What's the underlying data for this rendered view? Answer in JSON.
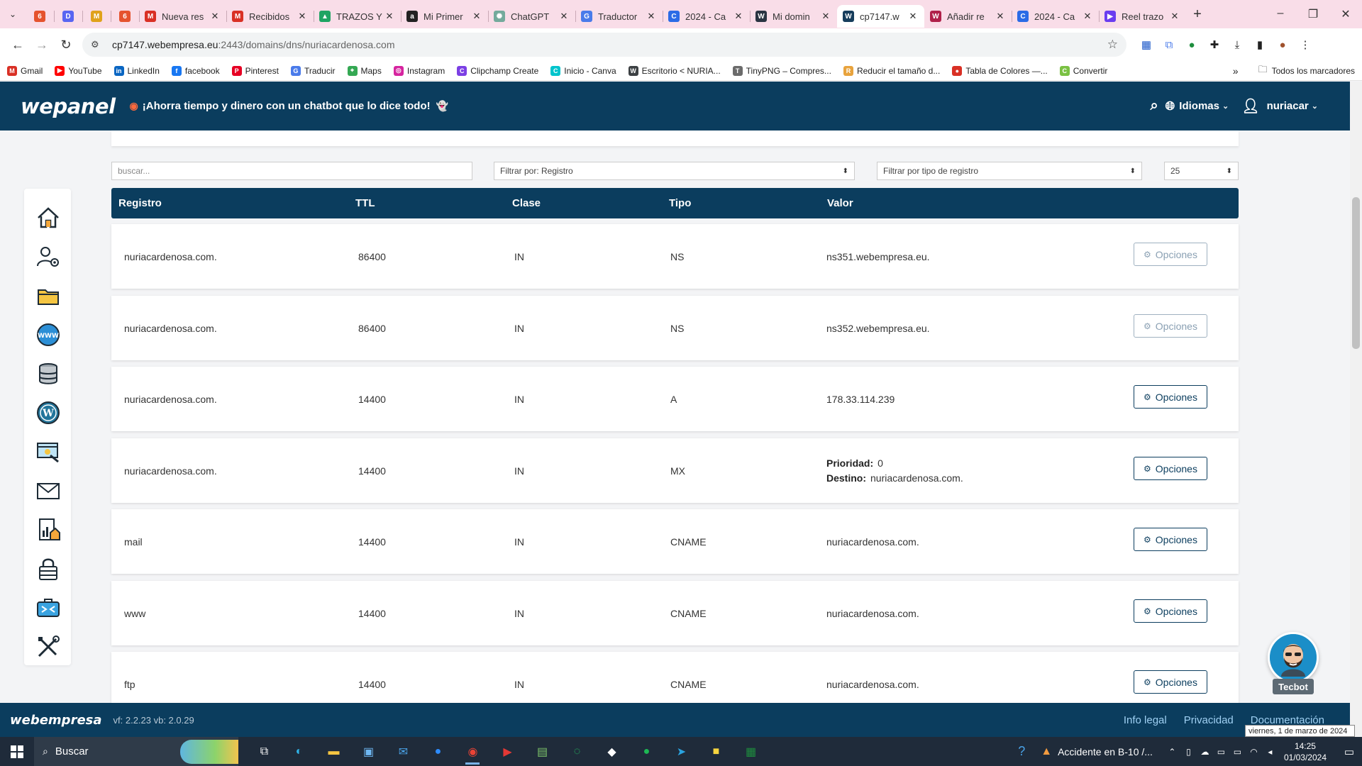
{
  "browser": {
    "tabs": [
      {
        "title": "",
        "color": "#e5532e",
        "glyph": "6",
        "small": true
      },
      {
        "title": "",
        "color": "#5865f2",
        "glyph": "D",
        "small": true
      },
      {
        "title": "",
        "color": "#e0a21b",
        "glyph": "M",
        "small": true
      },
      {
        "title": "",
        "color": "#e5532e",
        "glyph": "6",
        "small": true
      },
      {
        "title": "Nueva res",
        "color": "#d93025",
        "glyph": "M"
      },
      {
        "title": "Recibidos",
        "color": "#d93025",
        "glyph": "M"
      },
      {
        "title": "TRAZOS Y",
        "color": "#1fa463",
        "glyph": "▲"
      },
      {
        "title": "Mi Primer",
        "color": "#222222",
        "glyph": "a"
      },
      {
        "title": "ChatGPT",
        "color": "#74aa9c",
        "glyph": "✺"
      },
      {
        "title": "Traductor",
        "color": "#4a7bea",
        "glyph": "G"
      },
      {
        "title": "2024 - Ca",
        "color": "#2b6be6",
        "glyph": "C"
      },
      {
        "title": "Mi domin",
        "color": "#2a3442",
        "glyph": "W"
      },
      {
        "title": "cp7147.w",
        "color": "#173d5c",
        "glyph": "W",
        "active": true
      },
      {
        "title": "Añadir re",
        "color": "#b0204a",
        "glyph": "W"
      },
      {
        "title": "2024 - Ca",
        "color": "#2b6be6",
        "glyph": "C"
      },
      {
        "title": "Reel trazo",
        "color": "#6a3cf0",
        "glyph": "▶"
      }
    ],
    "url_host": "cp7147.webempresa.eu",
    "url_path": ":2443/domains/dns/nuriacardenosa.com",
    "bookmarks": [
      {
        "label": "Gmail",
        "color": "#d93025",
        "glyph": "M"
      },
      {
        "label": "YouTube",
        "color": "#ff0000",
        "glyph": "▶"
      },
      {
        "label": "LinkedIn",
        "color": "#0a66c2",
        "glyph": "in"
      },
      {
        "label": "facebook",
        "color": "#1877f2",
        "glyph": "f"
      },
      {
        "label": "Pinterest",
        "color": "#e60023",
        "glyph": "P"
      },
      {
        "label": "Traducir",
        "color": "#4a7bea",
        "glyph": "G"
      },
      {
        "label": "Maps",
        "color": "#34a853",
        "glyph": "⌖"
      },
      {
        "label": "Instagram",
        "color": "#d6249f",
        "glyph": "◎"
      },
      {
        "label": "Clipchamp Create",
        "color": "#7b3fe4",
        "glyph": "C"
      },
      {
        "label": "Inicio - Canva",
        "color": "#00c4cc",
        "glyph": "C"
      },
      {
        "label": "Escritorio < NURIA...",
        "color": "#3c4043",
        "glyph": "W"
      },
      {
        "label": "TinyPNG – Compres...",
        "color": "#6b6b6b",
        "glyph": "T"
      },
      {
        "label": "Reducir el tamaño d...",
        "color": "#e8a33d",
        "glyph": "R"
      },
      {
        "label": "Tabla de Colores —...",
        "color": "#d93025",
        "glyph": "●"
      },
      {
        "label": "Convertir",
        "color": "#7ac143",
        "glyph": "C"
      }
    ],
    "all_bookmarks": "Todos los marcadores"
  },
  "header": {
    "logo": "wepanel",
    "promo": "¡Ahorra tiempo y dinero con un chatbot que lo dice todo!",
    "languages": "Idiomas",
    "user": "nuriacar"
  },
  "filters": {
    "search_placeholder": "buscar...",
    "filter_record": "Filtrar por: Registro",
    "filter_type": "Filtrar por tipo de registro",
    "page_size": "25"
  },
  "table": {
    "columns": [
      "Registro",
      "TTL",
      "Clase",
      "Tipo",
      "Valor"
    ],
    "option_label": "Opciones",
    "rows": [
      {
        "registro": "nuriacardenosa.com.",
        "ttl": "86400",
        "clase": "IN",
        "tipo": "NS",
        "valor": "ns351.webempresa.eu.",
        "disabled": true
      },
      {
        "registro": "nuriacardenosa.com.",
        "ttl": "86400",
        "clase": "IN",
        "tipo": "NS",
        "valor": "ns352.webempresa.eu.",
        "disabled": true
      },
      {
        "registro": "nuriacardenosa.com.",
        "ttl": "14400",
        "clase": "IN",
        "tipo": "A",
        "valor": "178.33.114.239",
        "disabled": false
      },
      {
        "registro": "nuriacardenosa.com.",
        "ttl": "14400",
        "clase": "IN",
        "tipo": "MX",
        "valor": "",
        "prioridad_label": "Prioridad:",
        "prioridad": "0",
        "destino_label": "Destino:",
        "destino": "nuriacardenosa.com.",
        "disabled": false
      },
      {
        "registro": "mail",
        "ttl": "14400",
        "clase": "IN",
        "tipo": "CNAME",
        "valor": "nuriacardenosa.com.",
        "disabled": false
      },
      {
        "registro": "www",
        "ttl": "14400",
        "clase": "IN",
        "tipo": "CNAME",
        "valor": "nuriacardenosa.com.",
        "disabled": false
      },
      {
        "registro": "ftp",
        "ttl": "14400",
        "clase": "IN",
        "tipo": "CNAME",
        "valor": "nuriacardenosa.com.",
        "disabled": false
      }
    ]
  },
  "chatbot": {
    "label": "Tecbot"
  },
  "footer": {
    "logo": "webempresa",
    "version": "vf: 2.2.23 vb: 2.0.29",
    "links": [
      "Info legal",
      "Privacidad",
      "Documentación"
    ],
    "date_tooltip": "viernes, 1 de marzo de 2024"
  },
  "taskbar": {
    "search": "Buscar",
    "news": "Accidente en B-10 /...",
    "time": "14:25",
    "date": "01/03/2024"
  }
}
